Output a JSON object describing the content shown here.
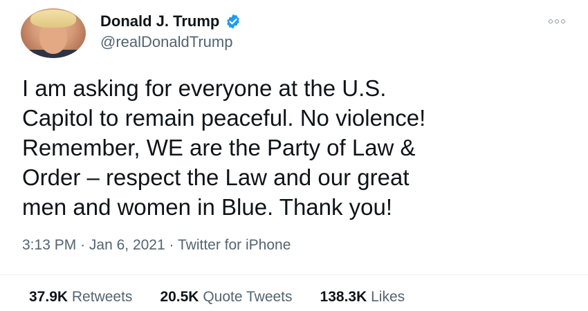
{
  "tweet": {
    "display_name": "Donald J. Trump",
    "handle": "@realDonaldTrump",
    "verified": true,
    "text": "I am asking for everyone at the U.S.\nCapitol to remain peaceful. No violence!\nRemember, WE are the Party of Law &\nOrder – respect the Law and our great\nmen and women in Blue. Thank you!",
    "time": "3:13 PM",
    "date": "Jan 6, 2021",
    "source": "Twitter for iPhone",
    "separator": "·",
    "stats": {
      "retweets_count": "37.9K",
      "retweets_label": "Retweets",
      "quote_count": "20.5K",
      "quote_label": "Quote Tweets",
      "likes_count": "138.3K",
      "likes_label": "Likes"
    }
  },
  "icons": {
    "verified": "verified-badge-icon",
    "more": "more-options-icon"
  },
  "colors": {
    "verified_blue": "#1d9bf0",
    "text_primary": "#0f1419",
    "text_secondary": "#536471"
  }
}
